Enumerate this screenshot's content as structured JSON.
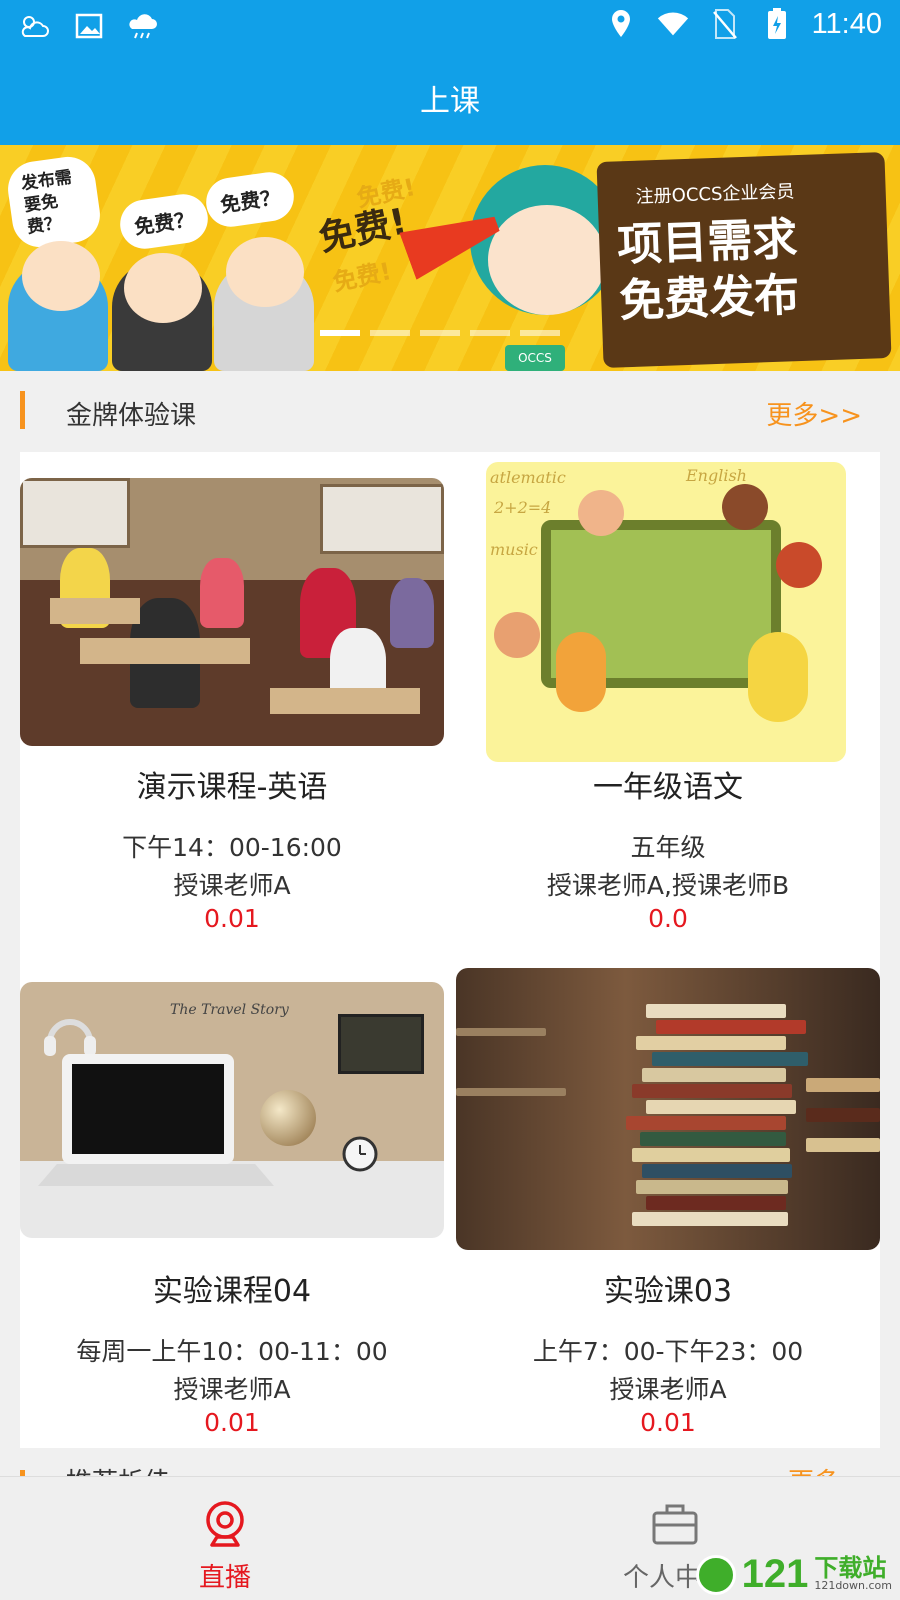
{
  "status_bar": {
    "time": "11:40",
    "left_icons": [
      "weather-icon",
      "image-icon",
      "cloud-icon"
    ],
    "right_icons": [
      "location-icon",
      "wifi-icon",
      "no-sim-icon",
      "battery-charging-icon"
    ]
  },
  "app_bar": {
    "title": "上课"
  },
  "banner": {
    "bubbles": [
      "发布需要免费？",
      "免费？",
      "免费？"
    ],
    "free_words": [
      "免费!",
      "免费!",
      "免费!"
    ],
    "promo_small": "注册OCCS企业会员",
    "promo_line1": "项目需求",
    "promo_line2": "免费发布",
    "shirt_text": "OCCS",
    "page_count": 5,
    "active_page": 1
  },
  "section": {
    "title": "金牌体验课",
    "more": "更多>>"
  },
  "courses": [
    {
      "title": "演示课程-英语",
      "time": "下午14：00-16:00",
      "teacher": "授课老师A",
      "price": "0.01"
    },
    {
      "title": "一年级语文",
      "time": "五年级",
      "teacher": "授课老师A,授课老师B",
      "price": "0.0",
      "thumb_texts": [
        "atlematic",
        "English",
        "music",
        "2+2=4"
      ]
    },
    {
      "title": "实验课程04",
      "time": "每周一上午10：00-11：00",
      "teacher": "授课老师A",
      "price": "0.01",
      "thumb_text": "The Travel Story"
    },
    {
      "title": "实验课03",
      "time": "上午7：00-下午23：00",
      "teacher": "授课老师A",
      "price": "0.01"
    }
  ],
  "next_section": {
    "title": "推荐析佳",
    "more": "更多"
  },
  "bottom_nav": [
    {
      "label": "直播",
      "icon": "webcam-icon",
      "active": true
    },
    {
      "label": "个人中心",
      "icon": "briefcase-icon",
      "active": false
    }
  ],
  "watermark": {
    "number": "121",
    "text": "下载站",
    "url": "121down.com"
  },
  "colors": {
    "primary": "#11a0e8",
    "accent": "#f7931e",
    "price": "#e5181f",
    "active_nav": "#e5181f"
  }
}
